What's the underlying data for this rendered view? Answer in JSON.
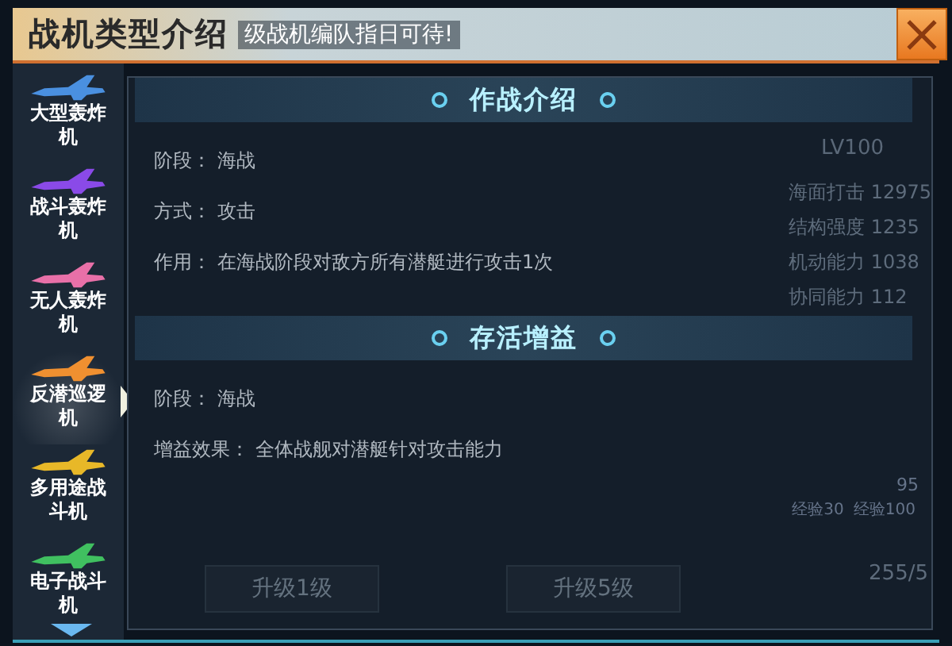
{
  "window": {
    "title": "战机类型介绍",
    "ticker": "级战机编队指日可待!"
  },
  "sidebar": {
    "items": [
      {
        "label": "大型轰炸机",
        "color": "#4a90e0",
        "selected": false
      },
      {
        "label": "战斗轰炸机",
        "color": "#8a4ae8",
        "selected": false
      },
      {
        "label": "无人轰炸机",
        "color": "#e870a8",
        "selected": false
      },
      {
        "label": "反潜巡逻机",
        "color": "#f09030",
        "selected": true
      },
      {
        "label": "多用途战斗机",
        "color": "#e8b828",
        "selected": false
      },
      {
        "label": "电子战斗机",
        "color": "#40c060",
        "selected": false
      }
    ]
  },
  "background": {
    "level_label": "LV100",
    "stats": [
      "海面打击 12975",
      "结构强度 1235",
      "机动能力 1038",
      "协同能力 112"
    ],
    "exp": [
      "经验30",
      "经验100"
    ],
    "count": "95",
    "total": "255/5",
    "buttons": [
      "升级1级",
      "升级5级"
    ]
  },
  "sections": [
    {
      "title": "作战介绍",
      "lines": [
        {
          "label": "阶段：",
          "value": "海战"
        },
        {
          "label": "方式：",
          "value": "攻击"
        },
        {
          "label": "作用：",
          "value": "在海战阶段对敌方所有潜艇进行攻击1次"
        }
      ]
    },
    {
      "title": "存活增益",
      "lines": [
        {
          "label": "阶段：",
          "value": "海战"
        },
        {
          "label": "增益效果：",
          "value": "全体战舰对潜艇针对攻击能力"
        }
      ]
    }
  ]
}
